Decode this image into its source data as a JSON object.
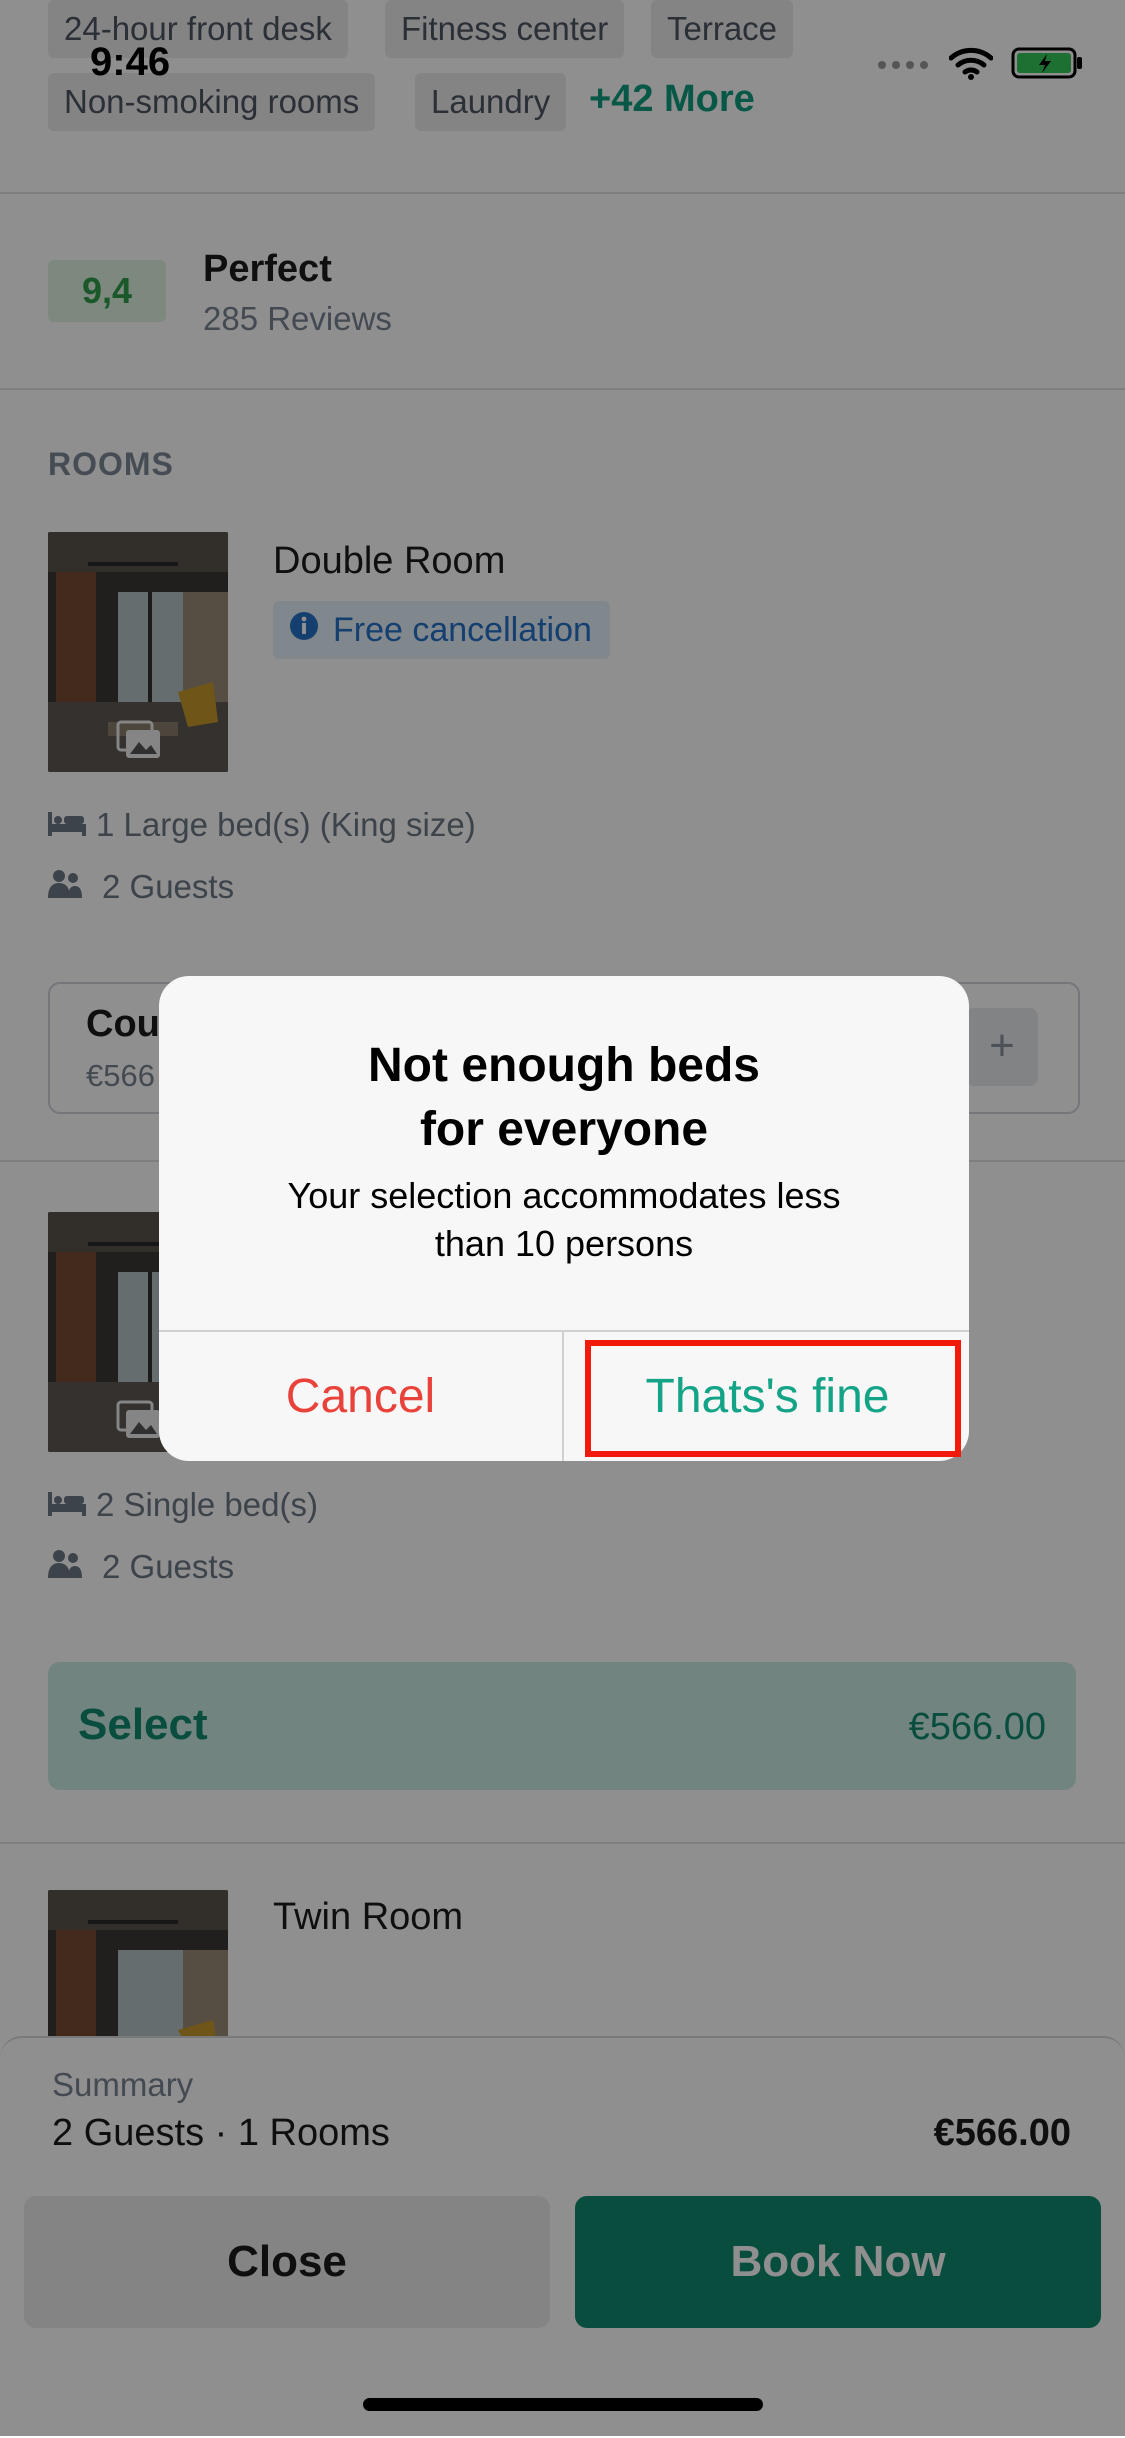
{
  "status_bar": {
    "time": "9:46"
  },
  "amenities": {
    "chips": [
      "24-hour front desk",
      "Fitness center",
      "Terrace",
      "Non-smoking rooms",
      "Laundry"
    ],
    "more_label": "+42 More"
  },
  "rating": {
    "score": "9,4",
    "title": "Perfect",
    "reviews": "285 Reviews"
  },
  "rooms": {
    "section_title": "ROOMS",
    "items": [
      {
        "name": "Double Room",
        "badge": "Free cancellation",
        "beds": "1 Large bed(s) (King size)",
        "guests": "2 Guests",
        "counter_title": "Cou",
        "counter_price": "€566"
      },
      {
        "beds": "2 Single bed(s)",
        "guests": "2 Guests",
        "select_label": "Select",
        "price": "€566.00"
      },
      {
        "name": "Twin Room"
      }
    ]
  },
  "summary": {
    "label": "Summary",
    "guests_rooms": "2 Guests · 1 Rooms",
    "price": "€566.00",
    "close_label": "Close",
    "book_label": "Book Now"
  },
  "dialog": {
    "title_line1": "Not enough beds",
    "title_line2": "for everyone",
    "message_line1": "Your selection accommodates less",
    "message_line2": "than 10 persons",
    "cancel_label": "Cancel",
    "confirm_label": "Thats's fine"
  },
  "colors": {
    "accent": "#0f8a6e",
    "dialog_confirm": "#13a387",
    "dialog_cancel": "#e8423a",
    "highlight_box": "#f21b0b",
    "rating_green": "#2f9b4a",
    "badge_blue": "#2570c4"
  },
  "icons": [
    "wifi-icon",
    "battery-icon",
    "signal-icon",
    "info-icon",
    "gallery-icon",
    "bed-icon",
    "guests-icon"
  ]
}
